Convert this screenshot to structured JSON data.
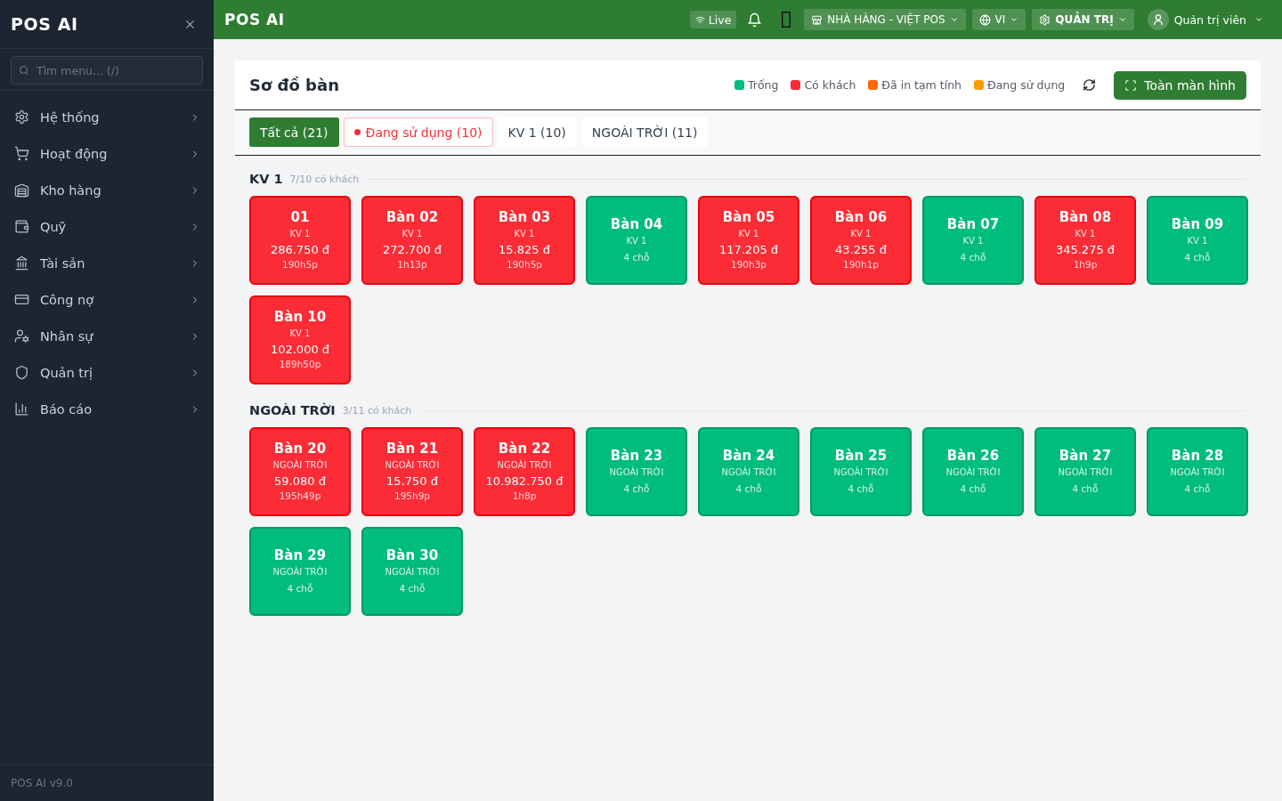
{
  "sidebar": {
    "brand": "POS AI",
    "search": {
      "placeholder": "Tìm menu... (/)"
    },
    "items": [
      {
        "label": "Hệ thống",
        "expanded": false
      },
      {
        "label": "Hoạt động",
        "expanded": false
      },
      {
        "label": "Kho hàng",
        "expanded": false
      },
      {
        "label": "Quỹ",
        "expanded": false
      },
      {
        "label": "Tài sản",
        "expanded": false
      },
      {
        "label": "Công nợ",
        "expanded": false
      },
      {
        "label": "Nhân sự",
        "expanded": false
      },
      {
        "label": "Quản trị",
        "expanded": false
      },
      {
        "label": "Báo cáo",
        "expanded": false
      }
    ],
    "footer": "POS AI v9.0"
  },
  "topbar": {
    "title": "POS AI",
    "live": "Live",
    "store": "NHÀ HÀNG - VIỆT POS",
    "language": "VI",
    "role": "QUẢN TRỊ",
    "user": "Quản trị viên"
  },
  "page": {
    "title": "Sơ đồ bàn",
    "legend": [
      {
        "label": "Trống",
        "color": "#00bc7d"
      },
      {
        "label": "Có khách",
        "color": "#fb2c36"
      },
      {
        "label": "Đã in tạm tính",
        "color": "#ff6900"
      },
      {
        "label": "Đang sử dụng",
        "color": "#fe9a00"
      }
    ],
    "fullscreen_button": "Toàn màn hình",
    "tabs": [
      {
        "label": "Tất cả (21)",
        "selected": true
      },
      {
        "label": "Đang sử dụng (10)",
        "selected": false,
        "color": "#fb2c36"
      },
      {
        "label": "KV 1 (10)",
        "selected": false
      },
      {
        "label": "NGOÀI TRỜI (11)",
        "selected": false
      }
    ]
  },
  "sections": [
    {
      "title": "KV 1",
      "summary": "7/10 có khách",
      "tables": [
        {
          "kind": "occupied",
          "name": "01",
          "area": "KV 1",
          "amount": "286.750 đ",
          "duration": "190h5p"
        },
        {
          "kind": "occupied",
          "name": "Bàn 02",
          "area": "KV 1",
          "amount": "272.700 đ",
          "duration": "1h13p"
        },
        {
          "kind": "occupied",
          "name": "Bàn 03",
          "area": "KV 1",
          "amount": "15.825 đ",
          "duration": "190h5p"
        },
        {
          "kind": "empty",
          "name": "Bàn 04",
          "area": "KV 1",
          "seats": "4 chỗ"
        },
        {
          "kind": "occupied",
          "name": "Bàn 05",
          "area": "KV 1",
          "amount": "117.205 đ",
          "duration": "190h3p"
        },
        {
          "kind": "occupied",
          "name": "Bàn 06",
          "area": "KV 1",
          "amount": "43.255 đ",
          "duration": "190h1p"
        },
        {
          "kind": "empty",
          "name": "Bàn 07",
          "area": "KV 1",
          "seats": "4 chỗ"
        },
        {
          "kind": "occupied",
          "name": "Bàn 08",
          "area": "KV 1",
          "amount": "345.275 đ",
          "duration": "1h9p"
        },
        {
          "kind": "empty",
          "name": "Bàn 09",
          "area": "KV 1",
          "seats": "4 chỗ"
        },
        {
          "kind": "occupied",
          "name": "Bàn 10",
          "area": "KV 1",
          "amount": "102.000 đ",
          "duration": "189h50p"
        }
      ]
    },
    {
      "title": "NGOÀI TRỜI",
      "summary": "3/11 có khách",
      "tables": [
        {
          "kind": "occupied",
          "name": "Bàn 20",
          "area": "NGOÀI TRỜI",
          "amount": "59.080 đ",
          "duration": "195h49p"
        },
        {
          "kind": "occupied",
          "name": "Bàn 21",
          "area": "NGOÀI TRỜI",
          "amount": "15.750 đ",
          "duration": "195h9p"
        },
        {
          "kind": "occupied",
          "name": "Bàn 22",
          "area": "NGOÀI TRỜI",
          "amount": "10.982.750 đ",
          "duration": "1h8p"
        },
        {
          "kind": "empty",
          "name": "Bàn 23",
          "area": "NGOÀI TRỜI",
          "seats": "4 chỗ"
        },
        {
          "kind": "empty",
          "name": "Bàn 24",
          "area": "NGOÀI TRỜI",
          "seats": "4 chỗ"
        },
        {
          "kind": "empty",
          "name": "Bàn 25",
          "area": "NGOÀI TRỜI",
          "seats": "4 chỗ"
        },
        {
          "kind": "empty",
          "name": "Bàn 26",
          "area": "NGOÀI TRỜI",
          "seats": "4 chỗ"
        },
        {
          "kind": "empty",
          "name": "Bàn 27",
          "area": "NGOÀI TRỜI",
          "seats": "4 chỗ"
        },
        {
          "kind": "empty",
          "name": "Bàn 28",
          "area": "NGOÀI TRỜI",
          "seats": "4 chỗ"
        },
        {
          "kind": "empty",
          "name": "Bàn 29",
          "area": "NGOÀI TRỜI",
          "seats": "4 chỗ"
        },
        {
          "kind": "empty",
          "name": "Bàn 30",
          "area": "NGOÀI TRỜI",
          "seats": "4 chỗ"
        }
      ]
    }
  ]
}
